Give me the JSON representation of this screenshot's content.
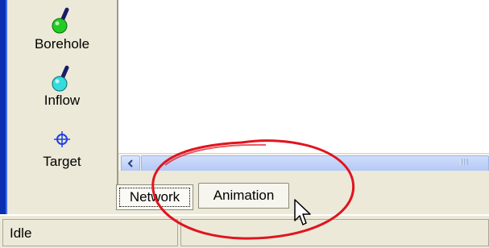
{
  "palette": {
    "items": [
      {
        "label": "Borehole",
        "icon": "borehole-pin-icon",
        "color": "#22cc22"
      },
      {
        "label": "Inflow",
        "icon": "inflow-pin-icon",
        "color": "#33dddd"
      },
      {
        "label": "Target",
        "icon": "target-crosshair-icon",
        "color": "#1f3fe0"
      }
    ]
  },
  "tabs": [
    {
      "label": "Network"
    },
    {
      "label": "Animation"
    }
  ],
  "status": {
    "text": "Idle"
  },
  "colors": {
    "annotation": "#e0141e",
    "selection": "#0a2fb0"
  }
}
